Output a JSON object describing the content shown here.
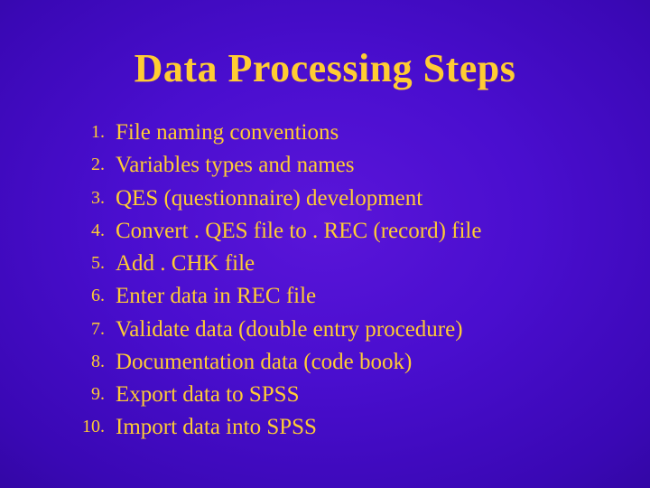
{
  "title": "Data Processing Steps",
  "steps": [
    "File naming conventions",
    "Variables types and names",
    "QES (questionnaire) development",
    "Convert . QES file to . REC (record) file",
    "Add . CHK file",
    "Enter data in REC file",
    "Validate data (double entry procedure)",
    "Documentation data (code book)",
    "Export data to SPSS",
    "Import data into SPSS"
  ]
}
